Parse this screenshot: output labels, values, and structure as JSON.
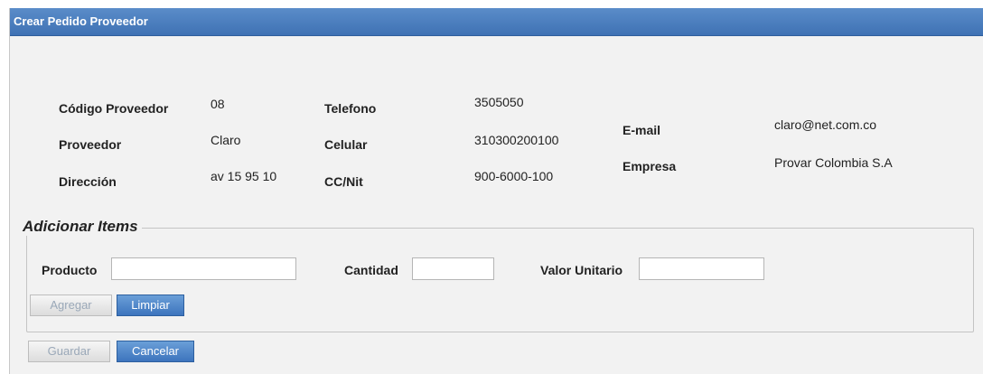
{
  "window": {
    "title": "Crear Pedido Proveedor"
  },
  "supplier": {
    "codigo_label": "Código Proveedor",
    "codigo_value": "08",
    "proveedor_label": "Proveedor",
    "proveedor_value": "Claro",
    "direccion_label": "Dirección",
    "direccion_value": "av 15 95 10",
    "telefono_label": "Telefono",
    "telefono_value": "3505050",
    "celular_label": "Celular",
    "celular_value": "310300200100",
    "ccnit_label": "CC/Nit",
    "ccnit_value": "900-6000-100",
    "email_label": "E-mail",
    "email_value": "claro@net.com.co",
    "empresa_label": "Empresa",
    "empresa_value": "Provar Colombia S.A"
  },
  "items": {
    "legend": "Adicionar Items",
    "producto_label": "Producto",
    "producto_value": "",
    "cantidad_label": "Cantidad",
    "cantidad_value": "",
    "valor_label": "Valor Unitario",
    "valor_value": "",
    "agregar_label": "Agregar",
    "limpiar_label": "Limpiar"
  },
  "actions": {
    "guardar_label": "Guardar",
    "cancelar_label": "Cancelar"
  },
  "colors": {
    "titlebar": "#4a7fc1",
    "primary_button": "#4a80c4",
    "disabled_text": "#9aa8b8",
    "panel_background": "#f2f2f2"
  }
}
